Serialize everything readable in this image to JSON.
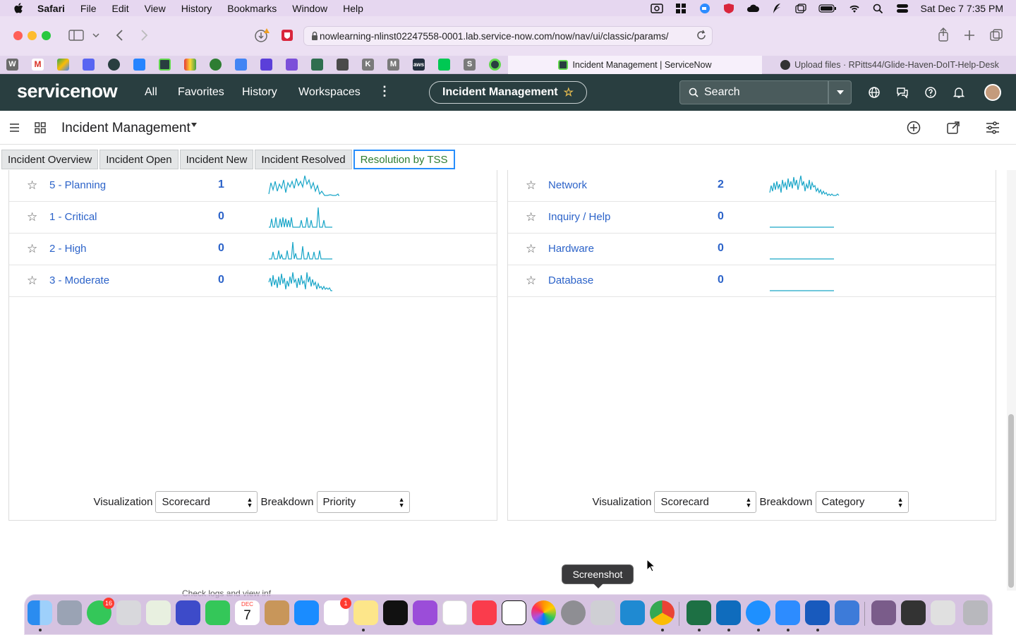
{
  "menubar": {
    "app_name": "Safari",
    "items": [
      "File",
      "Edit",
      "View",
      "History",
      "Bookmarks",
      "Window",
      "Help"
    ],
    "clock": "Sat Dec 7  7:35 PM"
  },
  "browser": {
    "url": "nowlearning-nlinst02247558-0001.lab.service-now.com/now/nav/ui/classic/params/",
    "tabs": [
      {
        "title": "Incident Management | ServiceNow",
        "active": true
      },
      {
        "title": "Upload files · RPitts44/Glide-Haven-DoIT-Help-Desk",
        "active": false
      }
    ],
    "bookmark_labels": [
      "W",
      "M",
      "K",
      "M",
      "aws",
      "S"
    ]
  },
  "servicenow": {
    "logo": "servicenow",
    "nav": [
      "All",
      "Favorites",
      "History",
      "Workspaces"
    ],
    "more": "⋮",
    "context_pill": "Incident Management",
    "search_placeholder": "Search"
  },
  "app_header": {
    "title": "Incident Management"
  },
  "dashboard_tabs": [
    "Incident Overview",
    "Incident Open",
    "Incident New",
    "Incident Resolved",
    "Resolution by TSS"
  ],
  "left_panel": {
    "rows": [
      {
        "label": "5 - Planning",
        "value": "1"
      },
      {
        "label": "1 - Critical",
        "value": "0"
      },
      {
        "label": "2 - High",
        "value": "0"
      },
      {
        "label": "3 - Moderate",
        "value": "0"
      }
    ],
    "visualization_label": "Visualization",
    "visualization_value": "Scorecard",
    "breakdown_label": "Breakdown",
    "breakdown_value": "Priority"
  },
  "right_panel": {
    "rows": [
      {
        "label": "Network",
        "value": "2"
      },
      {
        "label": "Inquiry / Help",
        "value": "0"
      },
      {
        "label": "Hardware",
        "value": "0"
      },
      {
        "label": "Database",
        "value": "0"
      }
    ],
    "visualization_label": "Visualization",
    "visualization_value": "Scorecard",
    "breakdown_label": "Breakdown",
    "breakdown_value": "Category"
  },
  "tooltip": "Screenshot",
  "status_text": "Check logs and view inf",
  "dock": {
    "badges": {
      "messages": "16",
      "reminders": "1"
    },
    "calendar_month": "DEC",
    "calendar_day": "7"
  },
  "colors": {
    "sn_header": "#293e40",
    "link_blue": "#2c63c9",
    "spark": "#1aa6c8",
    "active_tab_border": "#278efc"
  }
}
